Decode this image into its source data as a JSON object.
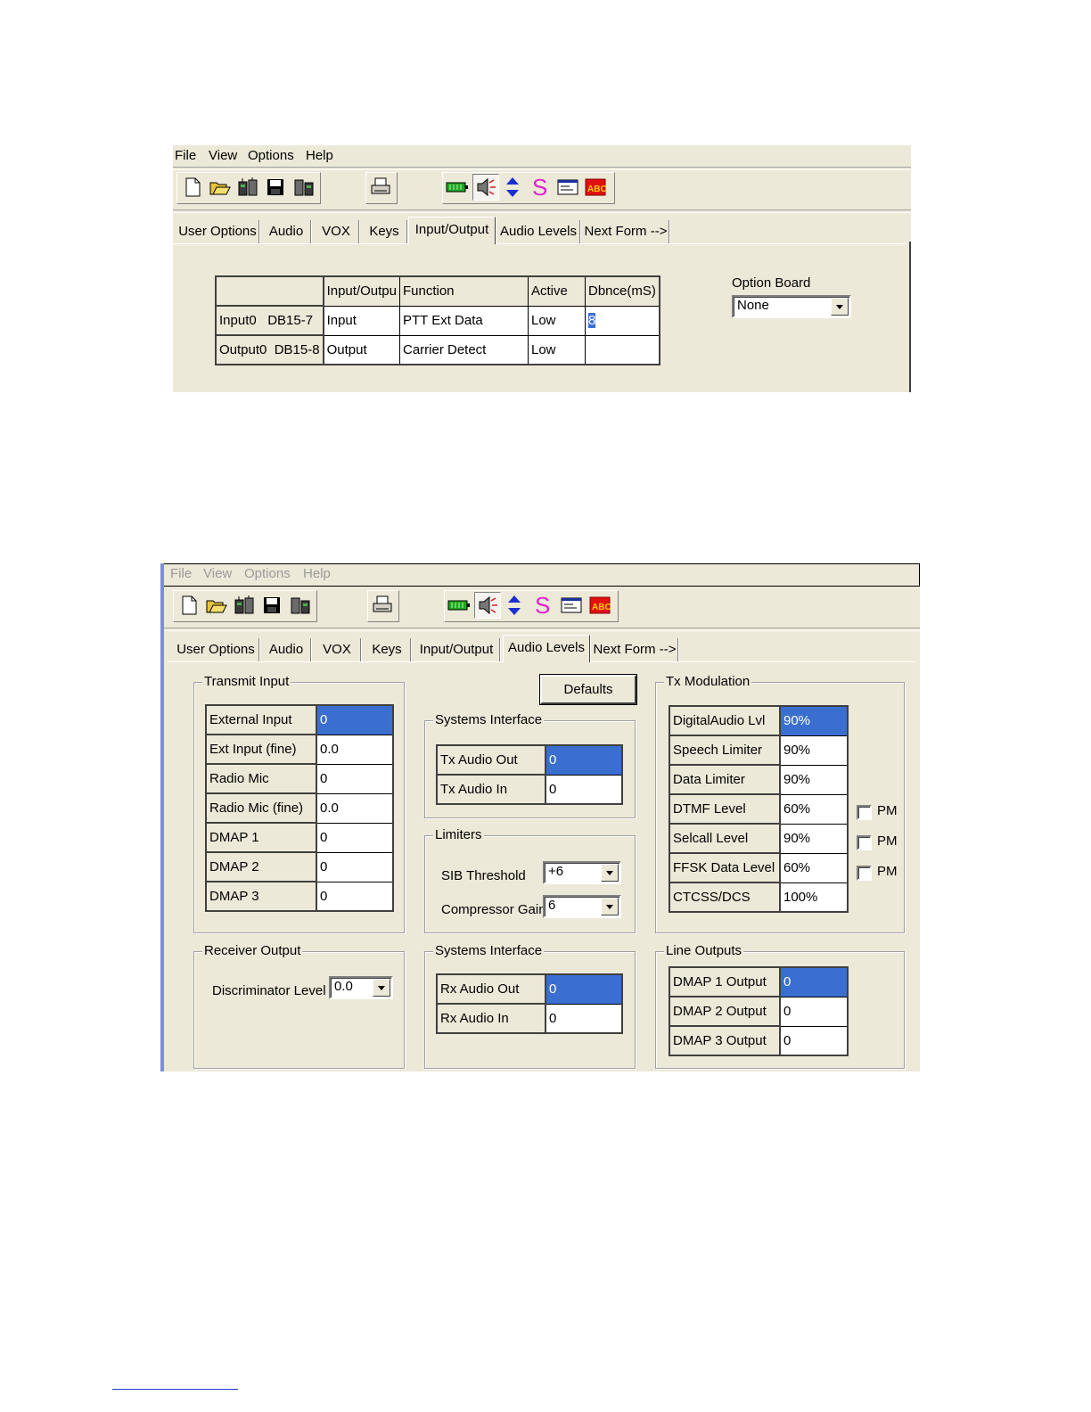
{
  "menu": [
    "File",
    "View",
    "Options",
    "Help"
  ],
  "tabs": [
    "User Options",
    "Audio",
    "VOX",
    "Keys",
    "Input/Output",
    "Audio Levels",
    "Next Form -->"
  ],
  "window1": {
    "active_tab": "Input/Output",
    "io_table": {
      "headers": [
        "",
        "Input/Outpu",
        "Function",
        "Active",
        "Dbnce(mS)"
      ],
      "rows": [
        [
          "Input0   DB15-7",
          "Input",
          "PTT Ext Data",
          "Low",
          "8"
        ],
        [
          "Output0  DB15-8",
          "Output",
          "Carrier Detect",
          "Low",
          ""
        ]
      ]
    },
    "option_board": {
      "label": "Option Board",
      "value": "None"
    }
  },
  "window2": {
    "active_tab": "Audio Levels",
    "defaults_label": "Defaults",
    "transmit_input": {
      "title": "Transmit Input",
      "rows": [
        [
          "External Input",
          "0"
        ],
        [
          "Ext Input (fine)",
          "0.0"
        ],
        [
          "Radio Mic",
          "0"
        ],
        [
          "Radio Mic (fine)",
          "0.0"
        ],
        [
          "DMAP 1",
          "0"
        ],
        [
          "DMAP 2",
          "0"
        ],
        [
          "DMAP 3",
          "0"
        ]
      ]
    },
    "systems_interface_tx": {
      "title": "Systems Interface",
      "rows": [
        [
          "Tx Audio Out",
          "0"
        ],
        [
          "Tx Audio In",
          "0"
        ]
      ]
    },
    "limiters": {
      "title": "Limiters",
      "sib_label": "SIB Threshold",
      "sib_value": "+6",
      "comp_label": "Compressor Gain",
      "comp_value": "6"
    },
    "tx_modulation": {
      "title": "Tx Modulation",
      "rows": [
        [
          "DigitalAudio Lvl",
          "90%"
        ],
        [
          "Speech Limiter",
          "90%"
        ],
        [
          "Data Limiter",
          "90%"
        ],
        [
          "DTMF Level",
          "60%"
        ],
        [
          "Selcall Level",
          "90%"
        ],
        [
          "FFSK Data Level",
          "60%"
        ],
        [
          "CTCSS/DCS",
          "100%"
        ]
      ],
      "pm_label": "PM"
    },
    "receiver_output": {
      "title": "Receiver Output",
      "disc_label": "Discriminator Level",
      "disc_value": "0.0"
    },
    "systems_interface_rx": {
      "title": "Systems Interface",
      "rows": [
        [
          "Rx Audio Out",
          "0"
        ],
        [
          "Rx Audio In",
          "0"
        ]
      ]
    },
    "line_outputs": {
      "title": "Line Outputs",
      "rows": [
        [
          "DMAP 1 Output",
          "0"
        ],
        [
          "DMAP 2 Output",
          "0"
        ],
        [
          "DMAP 3 Output",
          "0"
        ]
      ]
    }
  }
}
